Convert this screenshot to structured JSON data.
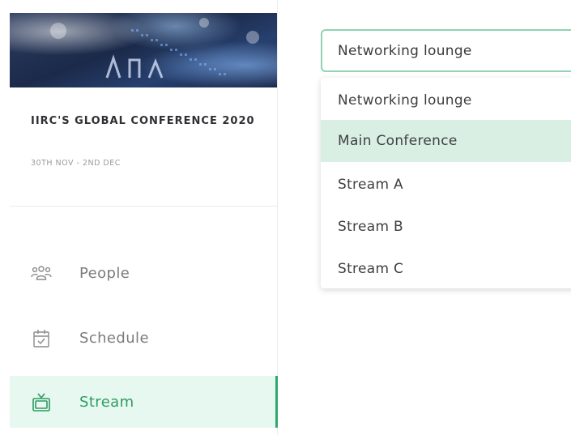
{
  "sidebar": {
    "event": {
      "title": "IIRC'S GLOBAL CONFERENCE 2020",
      "dates": "30TH NOV - 2ND DEC"
    },
    "nav": [
      {
        "label": "People",
        "icon": "people-icon",
        "active": false
      },
      {
        "label": "Schedule",
        "icon": "calendar-check-icon",
        "active": false
      },
      {
        "label": "Stream",
        "icon": "tv-icon",
        "active": true
      }
    ]
  },
  "stream_select": {
    "value": "Networking lounge",
    "options": [
      {
        "label": "Networking lounge",
        "highlighted": false
      },
      {
        "label": "Main Conference",
        "highlighted": true
      },
      {
        "label": "Stream A",
        "highlighted": false
      },
      {
        "label": "Stream B",
        "highlighted": false
      },
      {
        "label": "Stream C",
        "highlighted": false
      }
    ]
  },
  "colors": {
    "accent": "#2fa86e",
    "active_bg": "#e6f8ef",
    "option_highlight": "#d9efe3",
    "select_border": "#8fd3b2"
  }
}
